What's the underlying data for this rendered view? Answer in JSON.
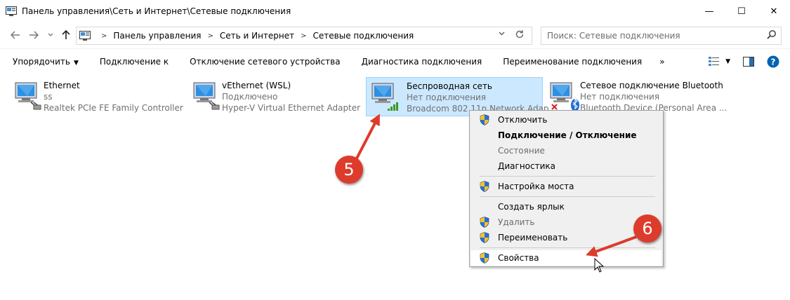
{
  "window": {
    "title": "Панель управления\\Сеть и Интернет\\Сетевые подключения",
    "minimize_glyph": "—",
    "maximize_glyph": "☐",
    "close_glyph": "✕"
  },
  "address": {
    "crumbs": [
      "Панель управления",
      "Сеть и Интернет",
      "Сетевые подключения"
    ],
    "search_placeholder": "Поиск: Сетевые подключения"
  },
  "toolbar": {
    "organize": "Упорядочить",
    "connect_to": "Подключение к",
    "disable_device": "Отключение сетевого устройства",
    "diagnose": "Диагностика подключения",
    "rename": "Переименование подключения",
    "more": "»"
  },
  "connections": [
    {
      "name": "Ethernet",
      "status": "ss",
      "device": "Realtek PCIe FE Family Controller"
    },
    {
      "name": "vEthernet (WSL)",
      "status": "Подключено",
      "device": "Hyper-V Virtual Ethernet Adapter"
    },
    {
      "name": "Беспроводная сеть",
      "status": "Нет подключения",
      "device": "Broadcom 802.11n Network Adap..."
    },
    {
      "name": "Сетевое подключение Bluetooth",
      "status": "Нет подключения",
      "device": "Bluetooth Device (Personal Area ..."
    }
  ],
  "context_menu": {
    "disable": "Отключить",
    "connect_disconnect": "Подключение / Отключение",
    "status": "Состояние",
    "diagnostics": "Диагностика",
    "bridge": "Настройка моста",
    "shortcut": "Создать ярлык",
    "delete": "Удалить",
    "rename": "Переименовать",
    "properties": "Свойства"
  },
  "annotations": {
    "step5": "5",
    "step6": "6"
  },
  "colors": {
    "selection_bg": "#cce8ff",
    "selection_border": "#99d1ff",
    "menu_bg": "#f0f0f0",
    "badge_red": "#dd3b2c",
    "help_blue": "#0063b1"
  },
  "icons": {
    "app": "network-folder-icon",
    "back": "arrow-left-icon",
    "forward": "arrow-right-icon",
    "up": "arrow-up-icon",
    "refresh": "refresh-icon",
    "search": "search-icon",
    "shield": "uac-shield-icon"
  }
}
